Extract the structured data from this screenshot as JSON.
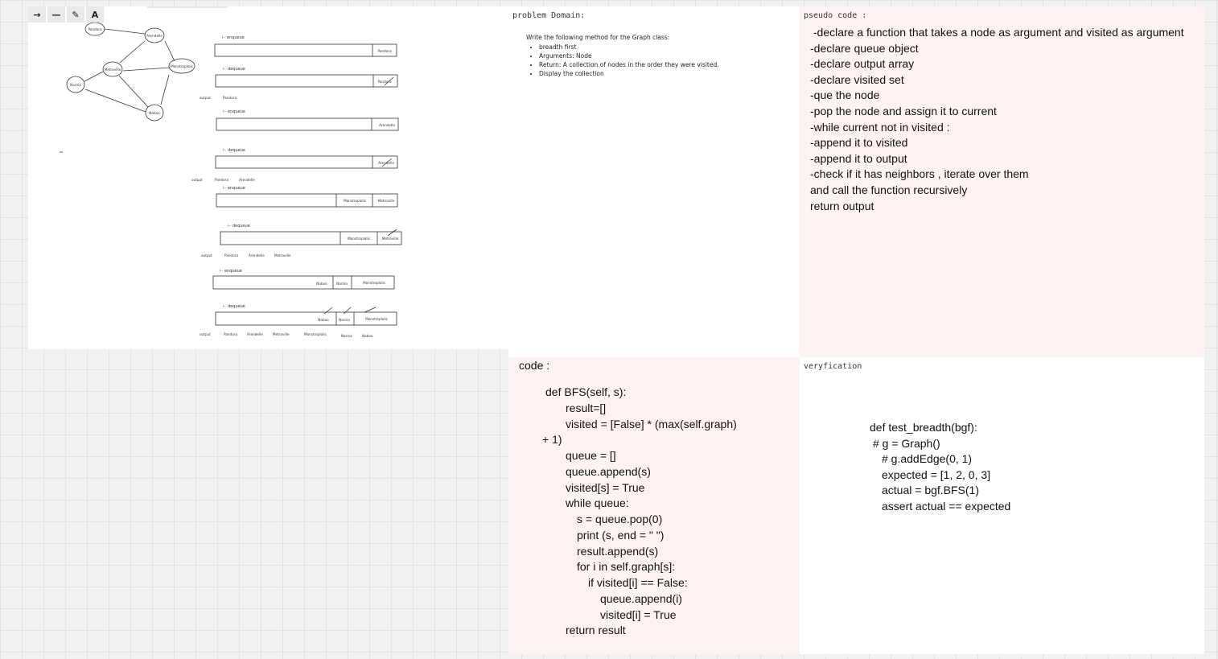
{
  "toolbar": {
    "tools": [
      {
        "name": "arrow-tool",
        "glyph": "→"
      },
      {
        "name": "line-tool",
        "glyph": "—"
      },
      {
        "name": "pen-tool",
        "glyph": "✎"
      },
      {
        "name": "text-tool",
        "glyph": "A"
      }
    ]
  },
  "sketch": {
    "graph_nodes": [
      "Pandora",
      "Arendelle",
      "Metroville",
      "Monstroplolis",
      "Narnia",
      "Naboo"
    ],
    "queue_step_labels": [
      "enqueue",
      "dequeue",
      "enqueue",
      "dequeue",
      "enqueue",
      "dequeue",
      "enqueue",
      "dequeue"
    ],
    "output_label": "output",
    "outputs": [
      [
        "Pandora"
      ],
      [
        "Pandora",
        "Arendelle"
      ],
      [
        "Pandora",
        "Arendelle",
        "Metroville"
      ],
      [
        "Pandora",
        "Arendelle",
        "Metroville",
        "Monstroplolis",
        "Narnia",
        "Naboo"
      ]
    ]
  },
  "problem": {
    "title": "problem Domain:",
    "intro": "Write the following method for the Graph class:",
    "bullets": [
      "breadth first",
      "Arguments: Node",
      "Return: A collection of nodes in the order they were visited.",
      "Display the collection"
    ]
  },
  "pseudo": {
    "title": "pseudo code :",
    "lines": [
      " -declare a function that takes a node as argument and visited as argument",
      "-declare queue object",
      "-declare output array",
      "-declare visited set",
      "-que the node",
      "-pop the node and assign it to current",
      "-while current not in visited :",
      "-append it to visited",
      "-append it to output",
      "-check if it has neighbors , iterate over them",
      "and call the function recursively",
      "return output"
    ]
  },
  "code": {
    "title": "code :",
    "lines": [
      "def BFS(self, s):",
      "result=[]",
      "visited = [False] * (max(self.graph)",
      "+ 1)",
      "queue = []",
      "queue.append(s)",
      "visited[s] = True",
      "while queue:",
      "s = queue.pop(0)",
      "print (s, end = \" \")",
      "result.append(s)",
      "for i in self.graph[s]:",
      "if visited[i] == False:",
      "queue.append(i)",
      "visited[i] = True",
      "return result"
    ]
  },
  "verify": {
    "title": "veryfication",
    "lines": [
      "def test_breadth(bgf):",
      "# g = Graph()",
      "# g.addEdge(0, 1)",
      "expected = [1, 2, 0, 3]",
      "actual = bgf.BFS(1)",
      "assert actual == expected"
    ]
  }
}
